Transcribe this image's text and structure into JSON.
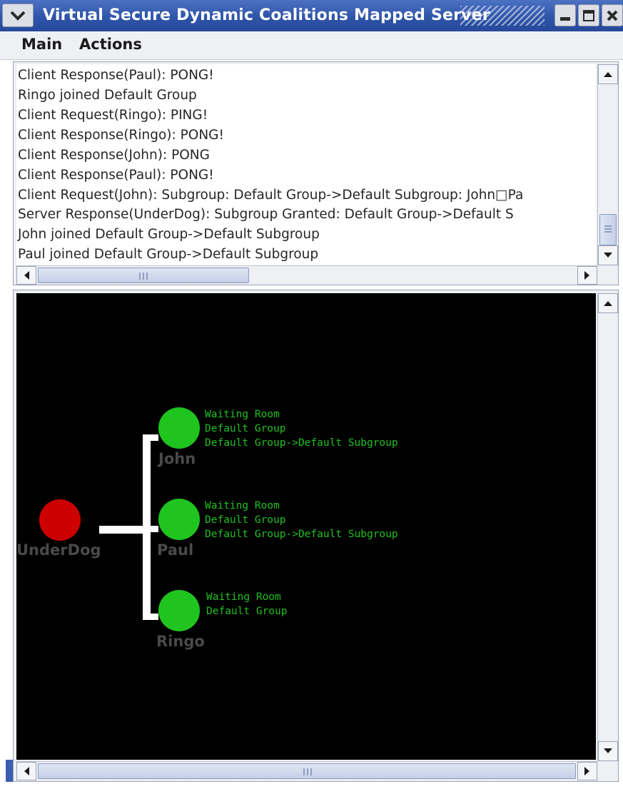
{
  "window": {
    "title": "Virtual Secure Dynamic Coalitions Mapped Server",
    "menu_icon": "chevron-down-icon",
    "buttons": [
      "minimize-icon",
      "maximize-icon",
      "close-icon"
    ]
  },
  "menubar": {
    "items": [
      "Main",
      "Actions"
    ]
  },
  "log": {
    "lines": [
      "Client Response(Paul): PONG!",
      "Ringo joined Default Group",
      "Client Request(Ringo): PING!",
      "Client Response(Ringo): PONG!",
      "Client Response(John): PONG",
      "Client Response(Paul): PONG!",
      "Client Request(John): Subgroup: Default Group->Default Subgroup: John□Pa",
      "Server Response(UnderDog): Subgroup Granted: Default Group->Default S",
      "John joined Default Group->Default Subgroup",
      "Paul joined Default Group->Default Subgroup"
    ]
  },
  "graph": {
    "root": {
      "name": "UnderDog",
      "color": "#cc0000"
    },
    "clients": [
      {
        "name": "John",
        "color": "#1fc41f",
        "groups": [
          "Waiting Room",
          "Default Group",
          "Default Group->Default Subgroup"
        ]
      },
      {
        "name": "Paul",
        "color": "#1fc41f",
        "groups": [
          "Waiting Room",
          "Default Group",
          "Default Group->Default Subgroup"
        ]
      },
      {
        "name": "Ringo",
        "color": "#1fc41f",
        "groups": [
          "Waiting Room",
          "Default Group"
        ]
      }
    ],
    "connector_color": "#ffffff",
    "text_color": "#21c021"
  }
}
